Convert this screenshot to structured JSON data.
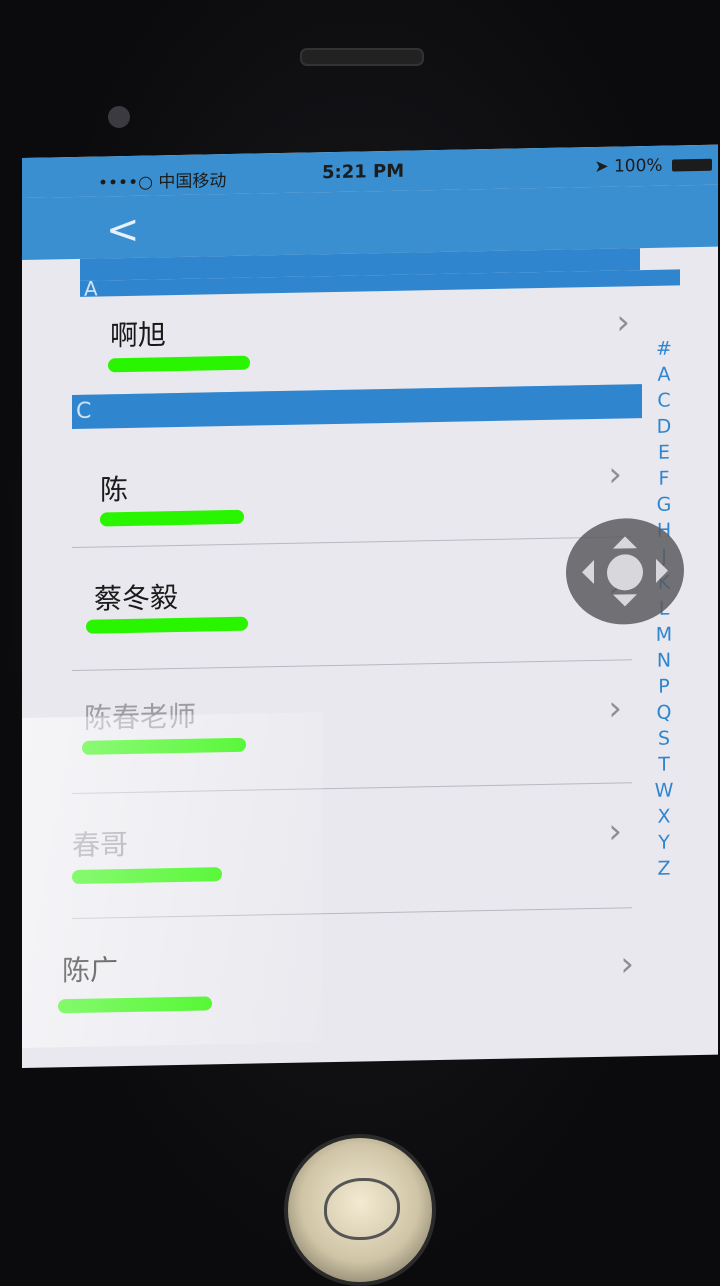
{
  "status_bar": {
    "carrier": "••••○ 中国移动",
    "wifi_icon": "wifi-icon",
    "time": "5:21 PM",
    "location_icon": "location-arrow-icon",
    "battery_text": "100%"
  },
  "nav": {
    "back_label": "<"
  },
  "sections": [
    {
      "header": "A",
      "rows": [
        {
          "name": "啊旭",
          "phone": ""
        }
      ]
    },
    {
      "header": "C",
      "rows": [
        {
          "name": "陈",
          "phone": ""
        },
        {
          "name": "蔡冬毅",
          "phone": ""
        },
        {
          "name": "陈春老师",
          "phone": ""
        },
        {
          "name": "春哥",
          "phone": ""
        },
        {
          "name": "陈广",
          "phone": ""
        }
      ]
    }
  ],
  "index_letters": [
    "#",
    "A",
    "C",
    "D",
    "E",
    "F",
    "G",
    "H",
    "J",
    "K",
    "L",
    "M",
    "N",
    "P",
    "Q",
    "S",
    "T",
    "W",
    "X",
    "Y",
    "Z"
  ],
  "colors": {
    "accent": "#2f86cf",
    "redaction": "#29f500"
  }
}
